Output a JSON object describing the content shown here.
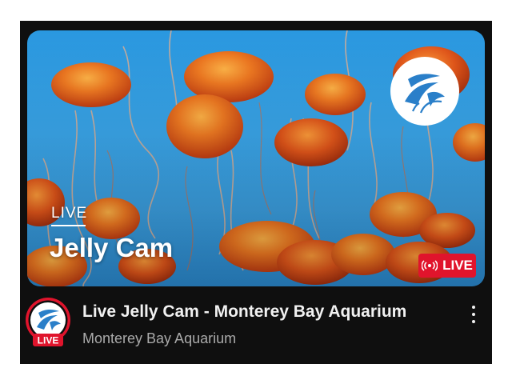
{
  "thumbnail": {
    "live_label": "LIVE",
    "title": "Jelly Cam",
    "live_badge": "LIVE",
    "badge_color": "#e0142c"
  },
  "video": {
    "title": "Live Jelly Cam - Monterey Bay Aquarium",
    "channel": "Monterey Bay Aquarium"
  },
  "avatar": {
    "live_label": "LIVE",
    "ring_color": "#e0142c"
  },
  "icons": {
    "menu": "more-vertical-icon",
    "broadcast": "broadcast-icon",
    "logo": "monterey-bay-aquarium-logo"
  },
  "colors": {
    "background": "#0f0f0f",
    "title_text": "#f1f1f1",
    "secondary_text": "#aaaaaa",
    "water": "#3aa6ea",
    "jelly": "#e8631e"
  }
}
